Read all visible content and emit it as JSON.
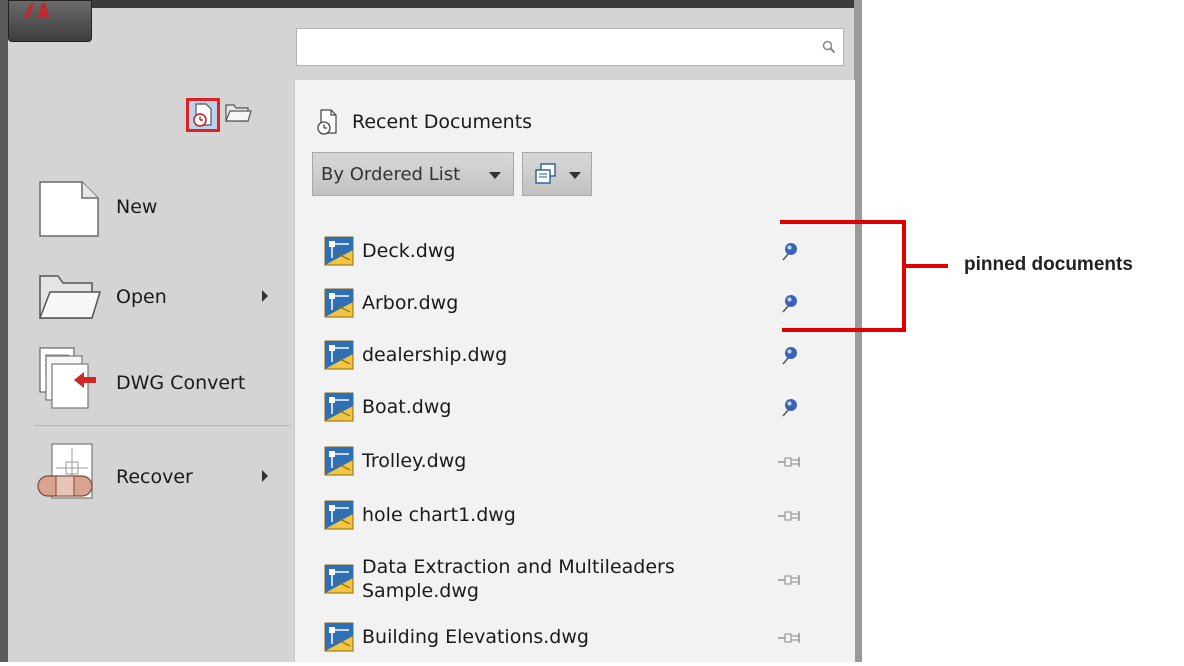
{
  "search": {
    "placeholder": ""
  },
  "view_toggles": [
    {
      "name": "recent-documents",
      "icon": "recent-documents-clock-icon",
      "selected": true
    },
    {
      "name": "open-documents",
      "icon": "open-folder-icon",
      "selected": false
    }
  ],
  "commands": [
    {
      "label": "New",
      "icon": "new-document-icon",
      "has_submenu": false
    },
    {
      "label": "Open",
      "icon": "open-folder-icon",
      "has_submenu": true
    },
    {
      "label": "DWG Convert",
      "icon": "dwg-convert-icon",
      "has_submenu": false
    },
    {
      "label": "Recover",
      "icon": "recover-bandage-icon",
      "has_submenu": true
    }
  ],
  "recent": {
    "title": "Recent Documents",
    "sort_label": "By Ordered List",
    "display_icon": "display-options-icon"
  },
  "documents": [
    {
      "name": "Deck.dwg",
      "pinned": true
    },
    {
      "name": "Arbor.dwg",
      "pinned": true
    },
    {
      "name": "dealership.dwg",
      "pinned": true
    },
    {
      "name": "Boat.dwg",
      "pinned": true
    },
    {
      "name": "Trolley.dwg",
      "pinned": false
    },
    {
      "name": "hole chart1.dwg",
      "pinned": false
    },
    {
      "name": "Data Extraction and Multileaders\nSample.dwg",
      "pinned": false
    },
    {
      "name": "Building Elevations.dwg",
      "pinned": false
    }
  ],
  "annotation": {
    "text": "pinned documents",
    "color": "#e00000"
  },
  "colors": {
    "selection_border": "#e02020",
    "pin_blue": "#3a63b8",
    "panel_bg": "#f2f2f2"
  }
}
